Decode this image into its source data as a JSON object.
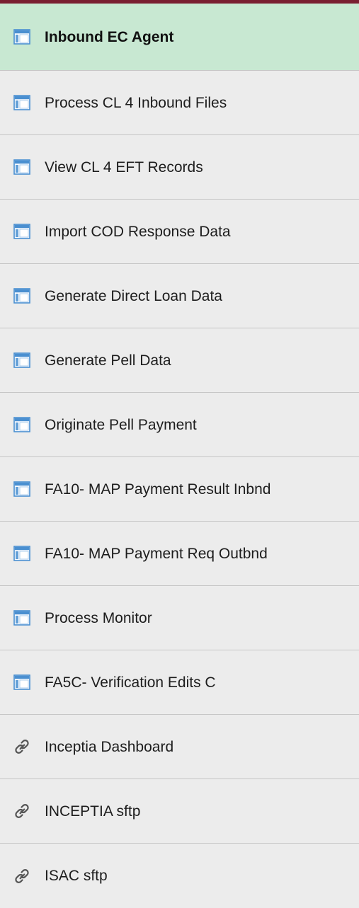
{
  "colors": {
    "top_border": "#7a1e31",
    "active_background": "#c8e8d2",
    "item_background": "#ececec",
    "divider": "#c6c6c6",
    "component_icon_blue": "#4a8fd0",
    "link_icon": "#555555"
  },
  "menu": {
    "items": [
      {
        "label": "Inbound EC Agent",
        "icon": "component-window-icon",
        "active": true
      },
      {
        "label": "Process CL 4 Inbound Files",
        "icon": "component-window-icon"
      },
      {
        "label": "View CL 4 EFT Records",
        "icon": "component-window-icon"
      },
      {
        "label": "Import COD Response Data",
        "icon": "component-window-icon"
      },
      {
        "label": "Generate Direct Loan Data",
        "icon": "component-window-icon"
      },
      {
        "label": "Generate Pell Data",
        "icon": "component-window-icon"
      },
      {
        "label": "Originate Pell Payment",
        "icon": "component-window-icon"
      },
      {
        "label": "FA10- MAP Payment Result Inbnd",
        "icon": "component-window-icon"
      },
      {
        "label": "FA10- MAP Payment Req Outbnd",
        "icon": "component-window-icon"
      },
      {
        "label": "Process Monitor",
        "icon": "component-window-icon"
      },
      {
        "label": "FA5C- Verification Edits C",
        "icon": "component-window-icon"
      },
      {
        "label": "Inceptia Dashboard",
        "icon": "link-icon"
      },
      {
        "label": "INCEPTIA  sftp",
        "icon": "link-icon"
      },
      {
        "label": "ISAC sftp",
        "icon": "link-icon"
      }
    ]
  }
}
